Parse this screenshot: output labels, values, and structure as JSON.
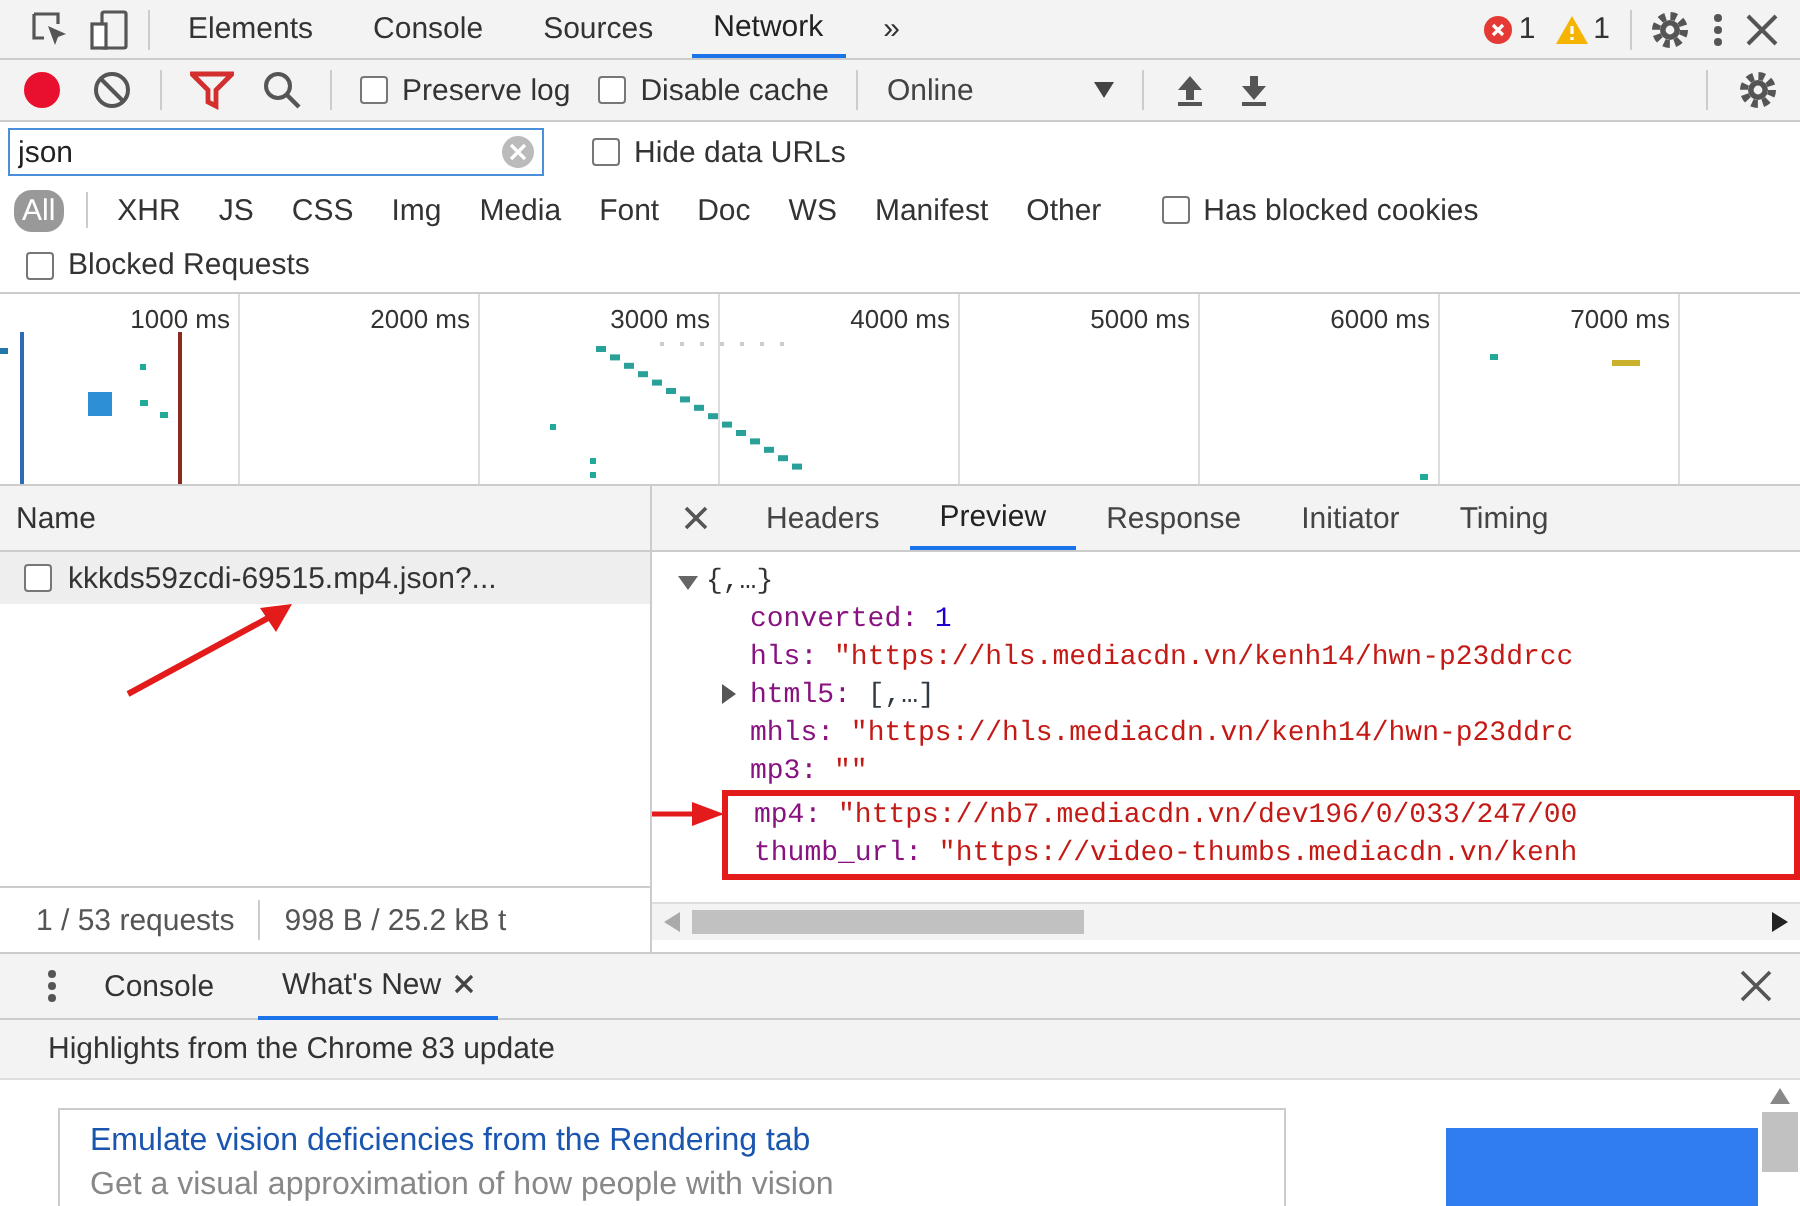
{
  "main_tabs": [
    {
      "label": "Elements",
      "selected": false
    },
    {
      "label": "Console",
      "selected": false
    },
    {
      "label": "Sources",
      "selected": false
    },
    {
      "label": "Network",
      "selected": true
    }
  ],
  "more_tabs": "»",
  "error_count": "1",
  "warning_count": "1",
  "toolbar": {
    "recording": true,
    "preserve_log": {
      "label": "Preserve log",
      "checked": false
    },
    "disable_cache": {
      "label": "Disable cache",
      "checked": false
    },
    "throttling": "Online"
  },
  "filter": {
    "value": "json",
    "hide_data_urls": {
      "label": "Hide data URLs",
      "checked": false
    }
  },
  "type_filters": [
    {
      "label": "All",
      "selected": true
    },
    {
      "label": "XHR",
      "selected": false
    },
    {
      "label": "JS",
      "selected": false
    },
    {
      "label": "CSS",
      "selected": false
    },
    {
      "label": "Img",
      "selected": false
    },
    {
      "label": "Media",
      "selected": false
    },
    {
      "label": "Font",
      "selected": false
    },
    {
      "label": "Doc",
      "selected": false
    },
    {
      "label": "WS",
      "selected": false
    },
    {
      "label": "Manifest",
      "selected": false
    },
    {
      "label": "Other",
      "selected": false
    }
  ],
  "has_blocked_cookies": {
    "label": "Has blocked cookies",
    "checked": false
  },
  "blocked_requests": {
    "label": "Blocked Requests",
    "checked": false
  },
  "timeline_ticks": [
    "1000 ms",
    "2000 ms",
    "3000 ms",
    "4000 ms",
    "5000 ms",
    "6000 ms",
    "7000 ms"
  ],
  "requests": {
    "column": "Name",
    "rows": [
      {
        "name": "kkkds59zcdi-69515.mp4.json?...",
        "checked": false,
        "selected": true
      }
    ]
  },
  "status_bar": {
    "requests": "1 / 53 requests",
    "transferred": "998 B / 25.2 kB t"
  },
  "detail_tabs": [
    {
      "label": "Headers",
      "selected": false
    },
    {
      "label": "Preview",
      "selected": true
    },
    {
      "label": "Response",
      "selected": false
    },
    {
      "label": "Initiator",
      "selected": false
    },
    {
      "label": "Timing",
      "selected": false
    }
  ],
  "preview": {
    "root": "{,…}",
    "expanded": true,
    "lines": [
      {
        "key": "converted:",
        "value": "1",
        "kind": "number",
        "expandable": false,
        "highlighted": false
      },
      {
        "key": "hls:",
        "value": "\"https://hls.mediacdn.vn/kenh14/hwn-p23ddrcc",
        "kind": "string",
        "expandable": false,
        "highlighted": false
      },
      {
        "key": "html5:",
        "value": "[,…]",
        "kind": "collapsed",
        "expandable": true,
        "highlighted": false
      },
      {
        "key": "mhls:",
        "value": "\"https://hls.mediacdn.vn/kenh14/hwn-p23ddrc",
        "kind": "string",
        "expandable": false,
        "highlighted": false
      },
      {
        "key": "mp3:",
        "value": "\"\"",
        "kind": "string",
        "expandable": false,
        "highlighted": false
      },
      {
        "key": "mp4:",
        "value": "\"https://nb7.mediacdn.vn/dev196/0/033/247/00",
        "kind": "string",
        "expandable": false,
        "highlighted": true
      },
      {
        "key": "thumb_url:",
        "value": "\"https://video-thumbs.mediacdn.vn/kenh",
        "kind": "string",
        "expandable": false,
        "highlighted": true
      }
    ]
  },
  "drawer": {
    "tabs": [
      {
        "label": "Console",
        "selected": false,
        "closable": false
      },
      {
        "label": "What's New",
        "selected": true,
        "closable": true
      }
    ],
    "heading": "Highlights from the Chrome 83 update",
    "card_title": "Emulate vision deficiencies from the Rendering tab",
    "card_text": "Get a visual approximation of how people with vision"
  }
}
